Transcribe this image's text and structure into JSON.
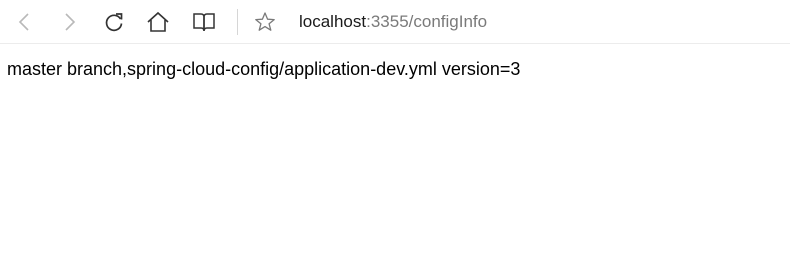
{
  "browser": {
    "address_bar": {
      "host": "localhost",
      "rest": ":3355/configInfo"
    },
    "icons": [
      "back-icon",
      "forward-icon",
      "refresh-icon",
      "home-icon",
      "reading-view-icon",
      "favorite-star-icon"
    ]
  },
  "page": {
    "body_text": "master branch,spring-cloud-config/application-dev.yml version=3"
  }
}
